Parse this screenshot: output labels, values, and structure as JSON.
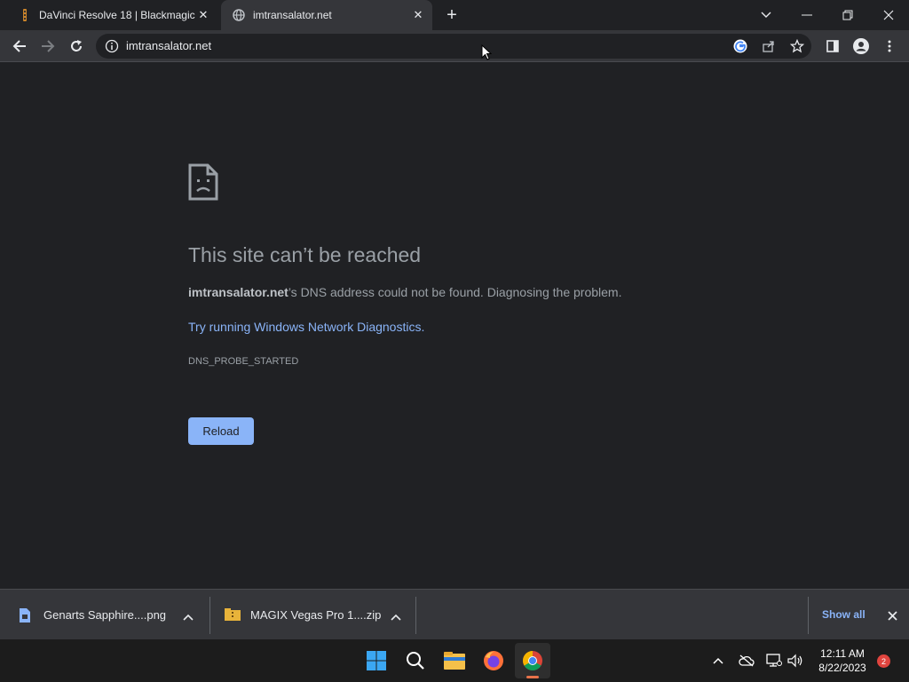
{
  "tabs": [
    {
      "title": "DaVinci Resolve 18 | Blackmagic",
      "active": false,
      "favicon": "davinci-icon"
    },
    {
      "title": "imtransalator.net",
      "active": true,
      "favicon": "globe-icon"
    }
  ],
  "window_controls": {
    "tab_search": "chevron-down-icon",
    "minimize": "minimize-icon",
    "restore": "restore-icon",
    "close": "close-icon"
  },
  "address_bar": {
    "url": "imtransalator.net"
  },
  "error_page": {
    "title": "This site can’t be reached",
    "domain": "imtransalator.net",
    "message_suffix": "’s DNS address could not be found. Diagnosing the problem.",
    "link": "Try running Windows Network Diagnostics.",
    "error_code": "DNS_PROBE_STARTED",
    "reload_label": "Reload"
  },
  "downloads": {
    "items": [
      {
        "name": "Genarts Sapphire....png",
        "icon": "image-file-icon"
      },
      {
        "name": "MAGIX Vegas Pro 1....zip",
        "icon": "zip-file-icon"
      }
    ],
    "show_all": "Show all"
  },
  "taskbar": {
    "apps": [
      "start-icon",
      "search-icon",
      "file-explorer-icon",
      "firefox-icon",
      "chrome-icon"
    ],
    "time": "12:11 AM",
    "date": "8/22/2023",
    "notification_count": "2"
  },
  "colors": {
    "accent": "#8ab4f8",
    "page_bg": "#202124",
    "toolbar_bg": "#35363a"
  }
}
